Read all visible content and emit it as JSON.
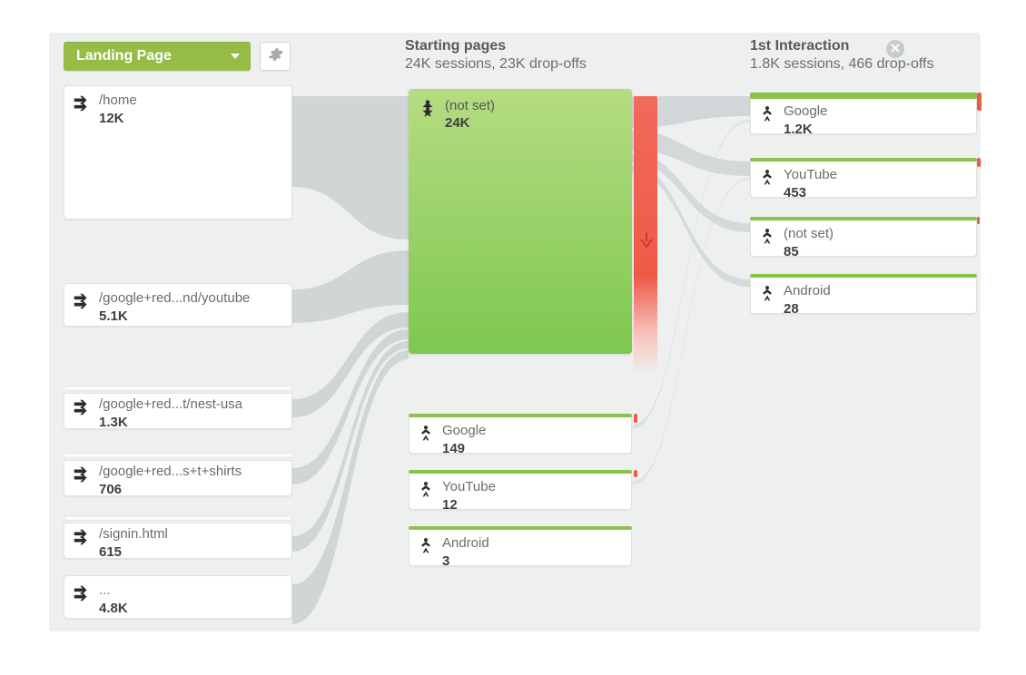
{
  "selector": {
    "label": "Landing Page"
  },
  "columns": {
    "starting": {
      "title": "Starting pages",
      "sub": "24K sessions, 23K drop-offs"
    },
    "first": {
      "title": "1st Interaction",
      "sub": "1.8K sessions, 466 drop-offs"
    }
  },
  "left_nodes": [
    {
      "label": "/home",
      "value": "12K"
    },
    {
      "label": "/google+red...nd/youtube",
      "value": "5.1K"
    },
    {
      "label": "/google+red...t/nest-usa",
      "value": "1.3K"
    },
    {
      "label": "/google+red...s+t+shirts",
      "value": "706"
    },
    {
      "label": "/signin.html",
      "value": "615"
    },
    {
      "label": "...",
      "value": "4.8K"
    }
  ],
  "starting_nodes": [
    {
      "label": "(not set)",
      "value": "24K"
    },
    {
      "label": "Google",
      "value": "149"
    },
    {
      "label": "YouTube",
      "value": "12"
    },
    {
      "label": "Android",
      "value": "3"
    }
  ],
  "first_nodes": [
    {
      "label": "Google",
      "value": "1.2K"
    },
    {
      "label": "YouTube",
      "value": "453"
    },
    {
      "label": "(not set)",
      "value": "85"
    },
    {
      "label": "Android",
      "value": "28"
    }
  ],
  "colors": {
    "accent": "#8bc34a",
    "drop": "#ef5a48"
  }
}
